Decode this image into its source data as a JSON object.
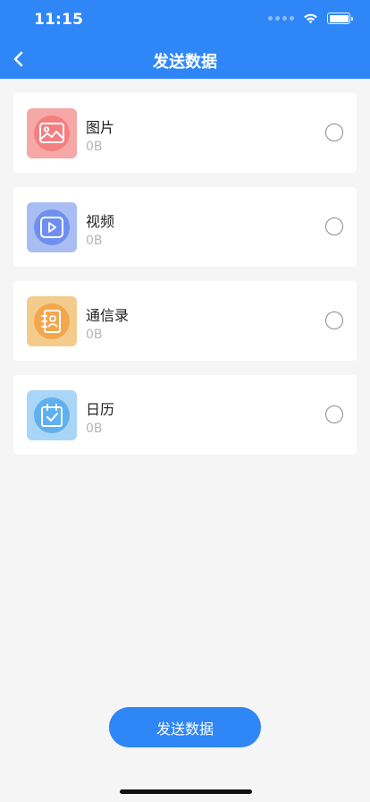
{
  "status_bar": {
    "time": "11:15"
  },
  "nav": {
    "title": "发送数据",
    "back_icon": "chevron-left-icon"
  },
  "items": [
    {
      "title": "图片",
      "size": "0B",
      "icon": "image-icon",
      "tile_color": "#f6a8a6",
      "circle_color": "#f37f80",
      "selected": false
    },
    {
      "title": "视频",
      "size": "0B",
      "icon": "video-play-icon",
      "tile_color": "#a9bdf3",
      "circle_color": "#6f8ff0",
      "selected": false
    },
    {
      "title": "通信录",
      "size": "0B",
      "icon": "contacts-book-icon",
      "tile_color": "#f3cc8c",
      "circle_color": "#f4a64c",
      "selected": false
    },
    {
      "title": "日历",
      "size": "0B",
      "icon": "calendar-check-icon",
      "tile_color": "#a9d6f6",
      "circle_color": "#5fb0f1",
      "selected": false
    }
  ],
  "send_button": {
    "label": "发送数据"
  },
  "colors": {
    "primary": "#2f86f6",
    "background": "#f5f5f5"
  }
}
